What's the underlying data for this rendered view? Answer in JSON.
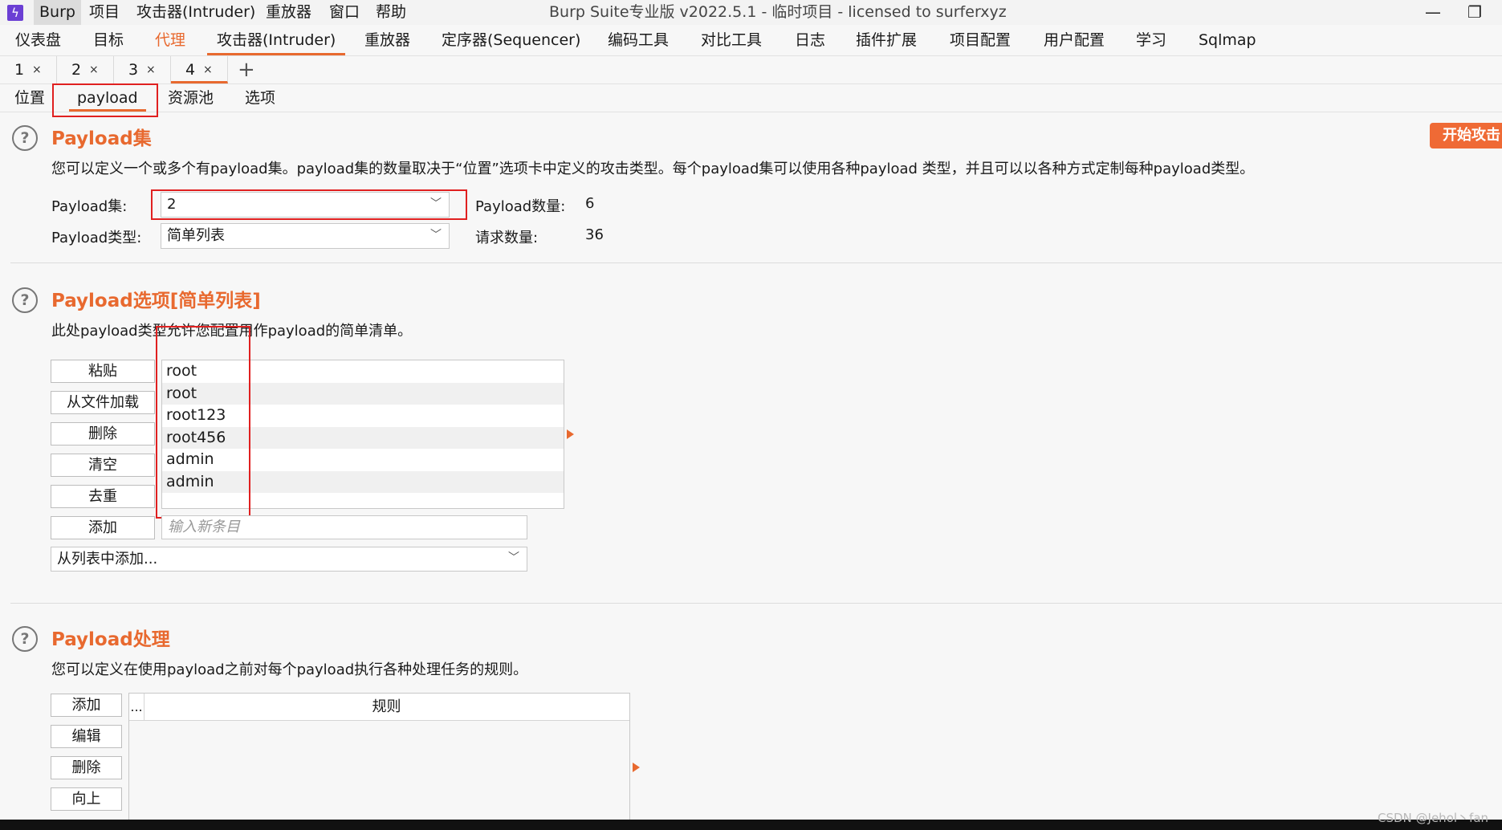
{
  "titlebar": {
    "menu": [
      "Burp",
      "项目",
      "攻击器(Intruder)",
      "重放器",
      "窗口",
      "帮助"
    ],
    "title": "Burp Suite专业版  v2022.5.1 - 临时项目 - licensed to surferxyz",
    "minimize": "—",
    "restore": "❐"
  },
  "main_tabs": [
    "仪表盘",
    "目标",
    "代理",
    "攻击器(Intruder)",
    "重放器",
    "定序器(Sequencer)",
    "编码工具",
    "对比工具",
    "日志",
    "插件扩展",
    "项目配置",
    "用户配置",
    "学习",
    "Sqlmap"
  ],
  "attack_tabs": [
    {
      "num": "1",
      "close": "×"
    },
    {
      "num": "2",
      "close": "×"
    },
    {
      "num": "3",
      "close": "×"
    },
    {
      "num": "4",
      "close": "×"
    }
  ],
  "add_tab": "+",
  "sub_tabs": [
    "位置",
    "payload",
    "资源池",
    "选项"
  ],
  "start_attack": "开始攻击",
  "payload_sets": {
    "title": "Payload集",
    "desc": "您可以定义一个或多个有payload集。payload集的数量取决于“位置”选项卡中定义的攻击类型。每个payload集可以使用各种payload 类型，并且可以以各种方式定制每种payload类型。",
    "set_label": "Payload集:",
    "set_value": "2",
    "type_label": "Payload类型:",
    "type_value": "简单列表",
    "count_label": "Payload数量:",
    "count_value": "6",
    "request_label": "请求数量:",
    "request_value": "36"
  },
  "payload_options": {
    "title": "Payload选项[简单列表]",
    "desc": "此处payload类型允许您配置用作payload的简单清单。",
    "buttons": {
      "paste": "粘贴",
      "load": "从文件加载",
      "remove": "删除",
      "clear": "清空",
      "dedupe": "去重",
      "add": "添加"
    },
    "items": [
      "root",
      "root",
      "root123",
      "root456",
      "admin",
      "admin"
    ],
    "new_item_placeholder": "输入新条目",
    "add_from_list": "从列表中添加..."
  },
  "payload_processing": {
    "title": "Payload处理",
    "desc": "您可以定义在使用payload之前对每个payload执行各种处理任务的规则。",
    "buttons": {
      "add": "添加",
      "edit": "编辑",
      "remove": "删除",
      "up": "向上"
    },
    "col_dots": "...",
    "col_rule": "规则"
  },
  "watermark": "CSDN @Jehol丶fan",
  "colors": {
    "accent": "#e8692f",
    "highlight_box": "#e02020"
  }
}
